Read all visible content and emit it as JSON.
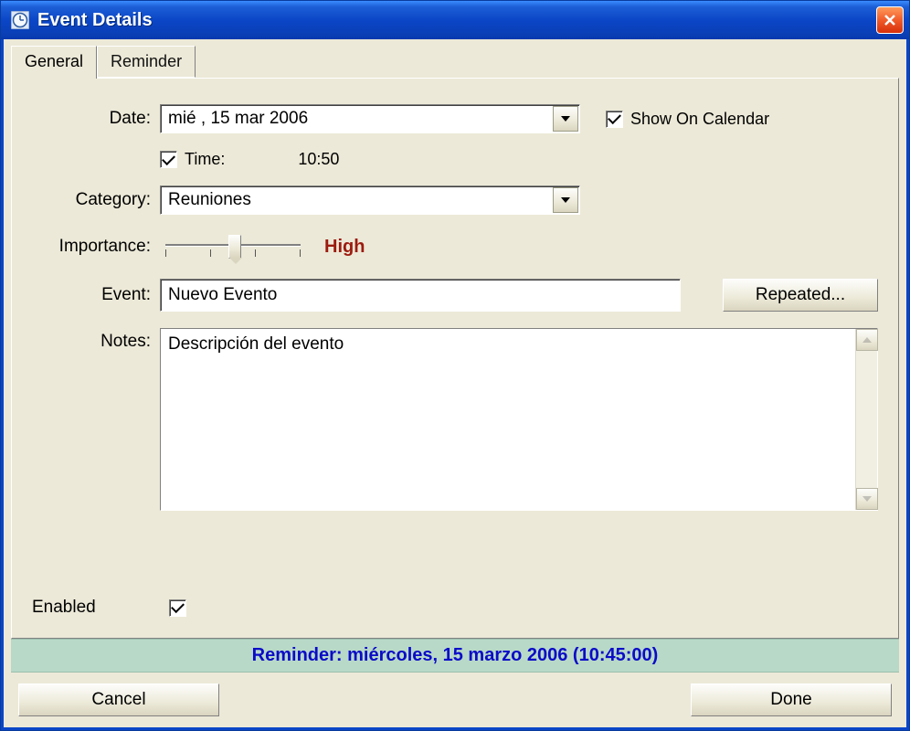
{
  "window": {
    "title": "Event Details"
  },
  "tabs": {
    "general": "General",
    "reminder": "Reminder"
  },
  "labels": {
    "date": "Date:",
    "showOnCalendar": "Show On Calendar",
    "time": "Time:",
    "category": "Category:",
    "importance": "Importance:",
    "event": "Event:",
    "notes": "Notes:",
    "enabled": "Enabled"
  },
  "fields": {
    "dateValue": "mié , 15 mar 2006",
    "showOnCalendarChecked": true,
    "timeChecked": true,
    "timeValue": "10:50",
    "categoryValue": "Reuniones",
    "importanceLevel": "High",
    "eventValue": "Nuevo Evento",
    "notesValue": "Descripción del evento",
    "enabledChecked": true
  },
  "buttons": {
    "repeated": "Repeated...",
    "cancel": "Cancel",
    "done": "Done"
  },
  "status": "Reminder: miércoles, 15 marzo 2006 (10:45:00)",
  "colors": {
    "importance": "#9c1b0f",
    "statusText": "#0b0bc8",
    "statusBg": "#b8d9c8",
    "titlebarStart": "#3a8cff",
    "titlebarEnd": "#0438ae"
  }
}
